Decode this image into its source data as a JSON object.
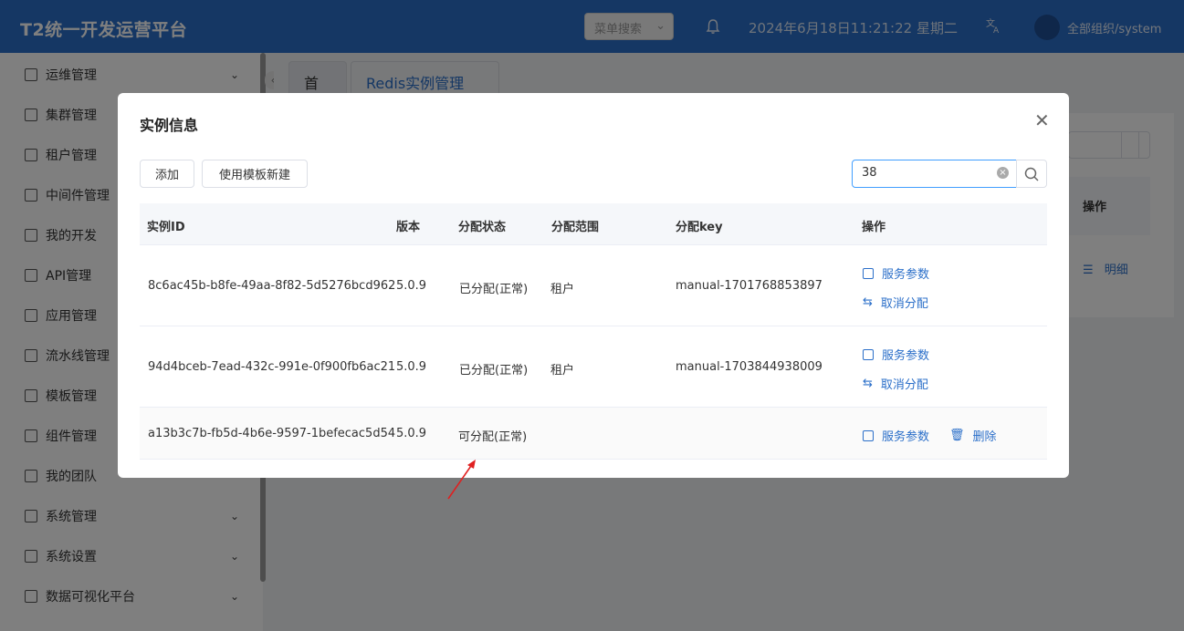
{
  "header": {
    "title": "T2统一开发运营平台",
    "menu_search_placeholder": "菜单搜索",
    "datetime": "2024年6月18日11:21:22 星期二",
    "org": "全部组织/system",
    "bg_color": "#2b6fc9"
  },
  "sidebar": {
    "items": [
      {
        "label": "运维管理",
        "icon": "ops-icon",
        "expandable": true
      },
      {
        "label": "集群管理",
        "icon": "cluster-icon",
        "expandable": false
      },
      {
        "label": "租户管理",
        "icon": "tenant-icon",
        "expandable": false
      },
      {
        "label": "中间件管理",
        "icon": "middleware-icon",
        "expandable": false
      },
      {
        "label": "我的开发",
        "icon": "dev-icon",
        "expandable": false
      },
      {
        "label": "API管理",
        "icon": "api-icon",
        "expandable": false
      },
      {
        "label": "应用管理",
        "icon": "app-icon",
        "expandable": false
      },
      {
        "label": "流水线管理",
        "icon": "pipeline-icon",
        "expandable": false
      },
      {
        "label": "模板管理",
        "icon": "template-icon",
        "expandable": false
      },
      {
        "label": "组件管理",
        "icon": "component-icon",
        "expandable": false
      },
      {
        "label": "我的团队",
        "icon": "team-icon",
        "expandable": false
      },
      {
        "label": "系统管理",
        "icon": "system-icon",
        "expandable": true
      },
      {
        "label": "系统设置",
        "icon": "settings-icon",
        "expandable": true
      },
      {
        "label": "数据可视化平台",
        "icon": "chart-icon",
        "expandable": true
      }
    ]
  },
  "tabs": [
    {
      "label": "首页"
    },
    {
      "label": "Redis实例管理"
    }
  ],
  "background_panel": {
    "header_label": "操作",
    "detail_link": "明细"
  },
  "modal": {
    "title": "实例信息",
    "add_button": "添加",
    "template_button": "使用模板新建",
    "search_value": "38",
    "columns": [
      "实例ID",
      "版本",
      "分配状态",
      "分配范围",
      "分配key",
      "操作"
    ],
    "rows": [
      {
        "id": "8c6ac45b-b8fe-49aa-8f82-5d5276bcd962",
        "version": "5.0.9",
        "status": "已分配(正常)",
        "scope": "租户",
        "key": "manual-1701768853897",
        "actions": [
          "服务参数",
          "取消分配"
        ]
      },
      {
        "id": "94d4bceb-7ead-432c-991e-0f900fb6ac21",
        "version": "5.0.9",
        "status": "已分配(正常)",
        "scope": "租户",
        "key": "manual-1703844938009",
        "actions": [
          "服务参数",
          "取消分配"
        ]
      },
      {
        "id": "a13b3c7b-fb5d-4b6e-9597-1befecac5d54",
        "version": "5.0.9",
        "status": "可分配(正常)",
        "scope": "",
        "key": "",
        "actions": [
          "服务参数",
          "删除"
        ]
      }
    ]
  }
}
